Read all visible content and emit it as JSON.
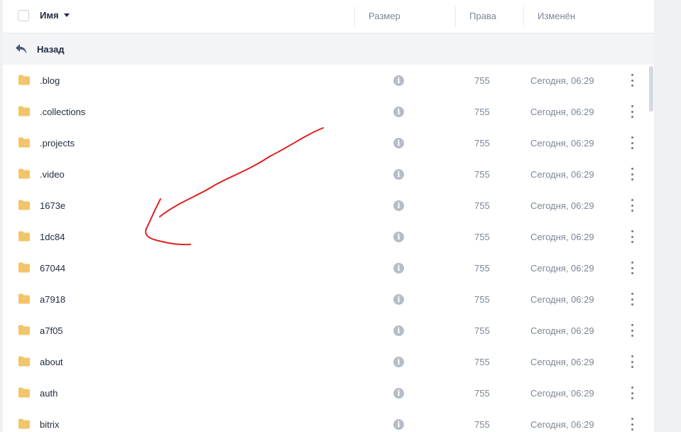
{
  "header": {
    "name_label": "Имя",
    "size_label": "Размер",
    "perms_label": "Права",
    "modified_label": "Изменён"
  },
  "back": {
    "label": "Назад"
  },
  "files": [
    {
      "name": ".blog",
      "perms": "755",
      "modified": "Сегодня, 06:29"
    },
    {
      "name": ".collections",
      "perms": "755",
      "modified": "Сегодня, 06:29"
    },
    {
      "name": ".projects",
      "perms": "755",
      "modified": "Сегодня, 06:29"
    },
    {
      "name": ".video",
      "perms": "755",
      "modified": "Сегодня, 06:29"
    },
    {
      "name": "1673e",
      "perms": "755",
      "modified": "Сегодня, 06:29"
    },
    {
      "name": "1dc84",
      "perms": "755",
      "modified": "Сегодня, 06:29"
    },
    {
      "name": "67044",
      "perms": "755",
      "modified": "Сегодня, 06:29"
    },
    {
      "name": "a7918",
      "perms": "755",
      "modified": "Сегодня, 06:29"
    },
    {
      "name": "a7f05",
      "perms": "755",
      "modified": "Сегодня, 06:29"
    },
    {
      "name": "about",
      "perms": "755",
      "modified": "Сегодня, 06:29"
    },
    {
      "name": "auth",
      "perms": "755",
      "modified": "Сегодня, 06:29"
    },
    {
      "name": "bitrix",
      "perms": "755",
      "modified": "Сегодня, 06:29"
    }
  ],
  "icons": {
    "folder": "folder-icon",
    "info": "info-icon",
    "menu": "more-vertical-icon",
    "back": "back-arrow-icon",
    "sort": "sort-down-icon"
  },
  "colors": {
    "folder": "#f2c56b",
    "annotation": "#e02020",
    "muted_text": "#7c8796"
  }
}
